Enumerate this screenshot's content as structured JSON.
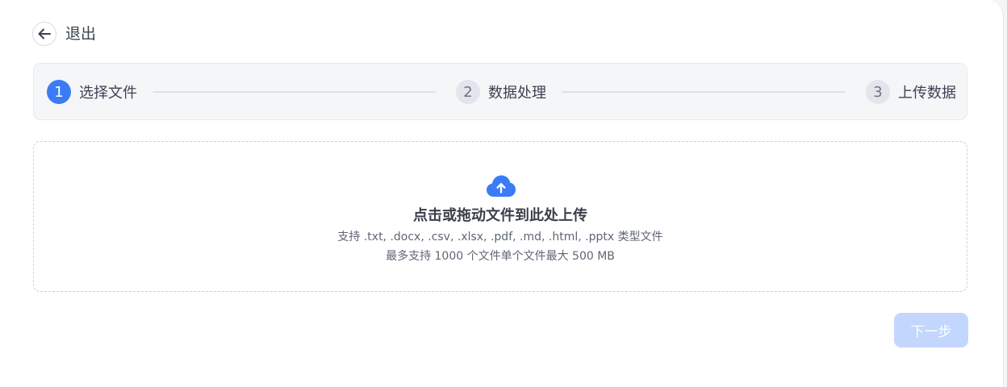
{
  "header": {
    "back_label": "退出"
  },
  "steps": [
    {
      "number": "1",
      "label": "选择文件",
      "state": "active"
    },
    {
      "number": "2",
      "label": "数据处理",
      "state": "inactive"
    },
    {
      "number": "3",
      "label": "上传数据",
      "state": "inactive"
    }
  ],
  "upload": {
    "title": "点击或拖动文件到此处上传",
    "supported_types": "支持 .txt, .docx, .csv, .xlsx, .pdf, .md, .html, .pptx 类型文件",
    "limits": "最多支持 1000 个文件单个文件最大 500 MB"
  },
  "footer": {
    "next_label": "下一步",
    "next_enabled": false
  },
  "colors": {
    "accent": "#3b7cf6",
    "step_inactive_bg": "#e2e5ec",
    "next_disabled_bg": "#c3d6fd"
  },
  "icons": {
    "back": "arrow-left-icon",
    "upload": "cloud-upload-icon"
  }
}
